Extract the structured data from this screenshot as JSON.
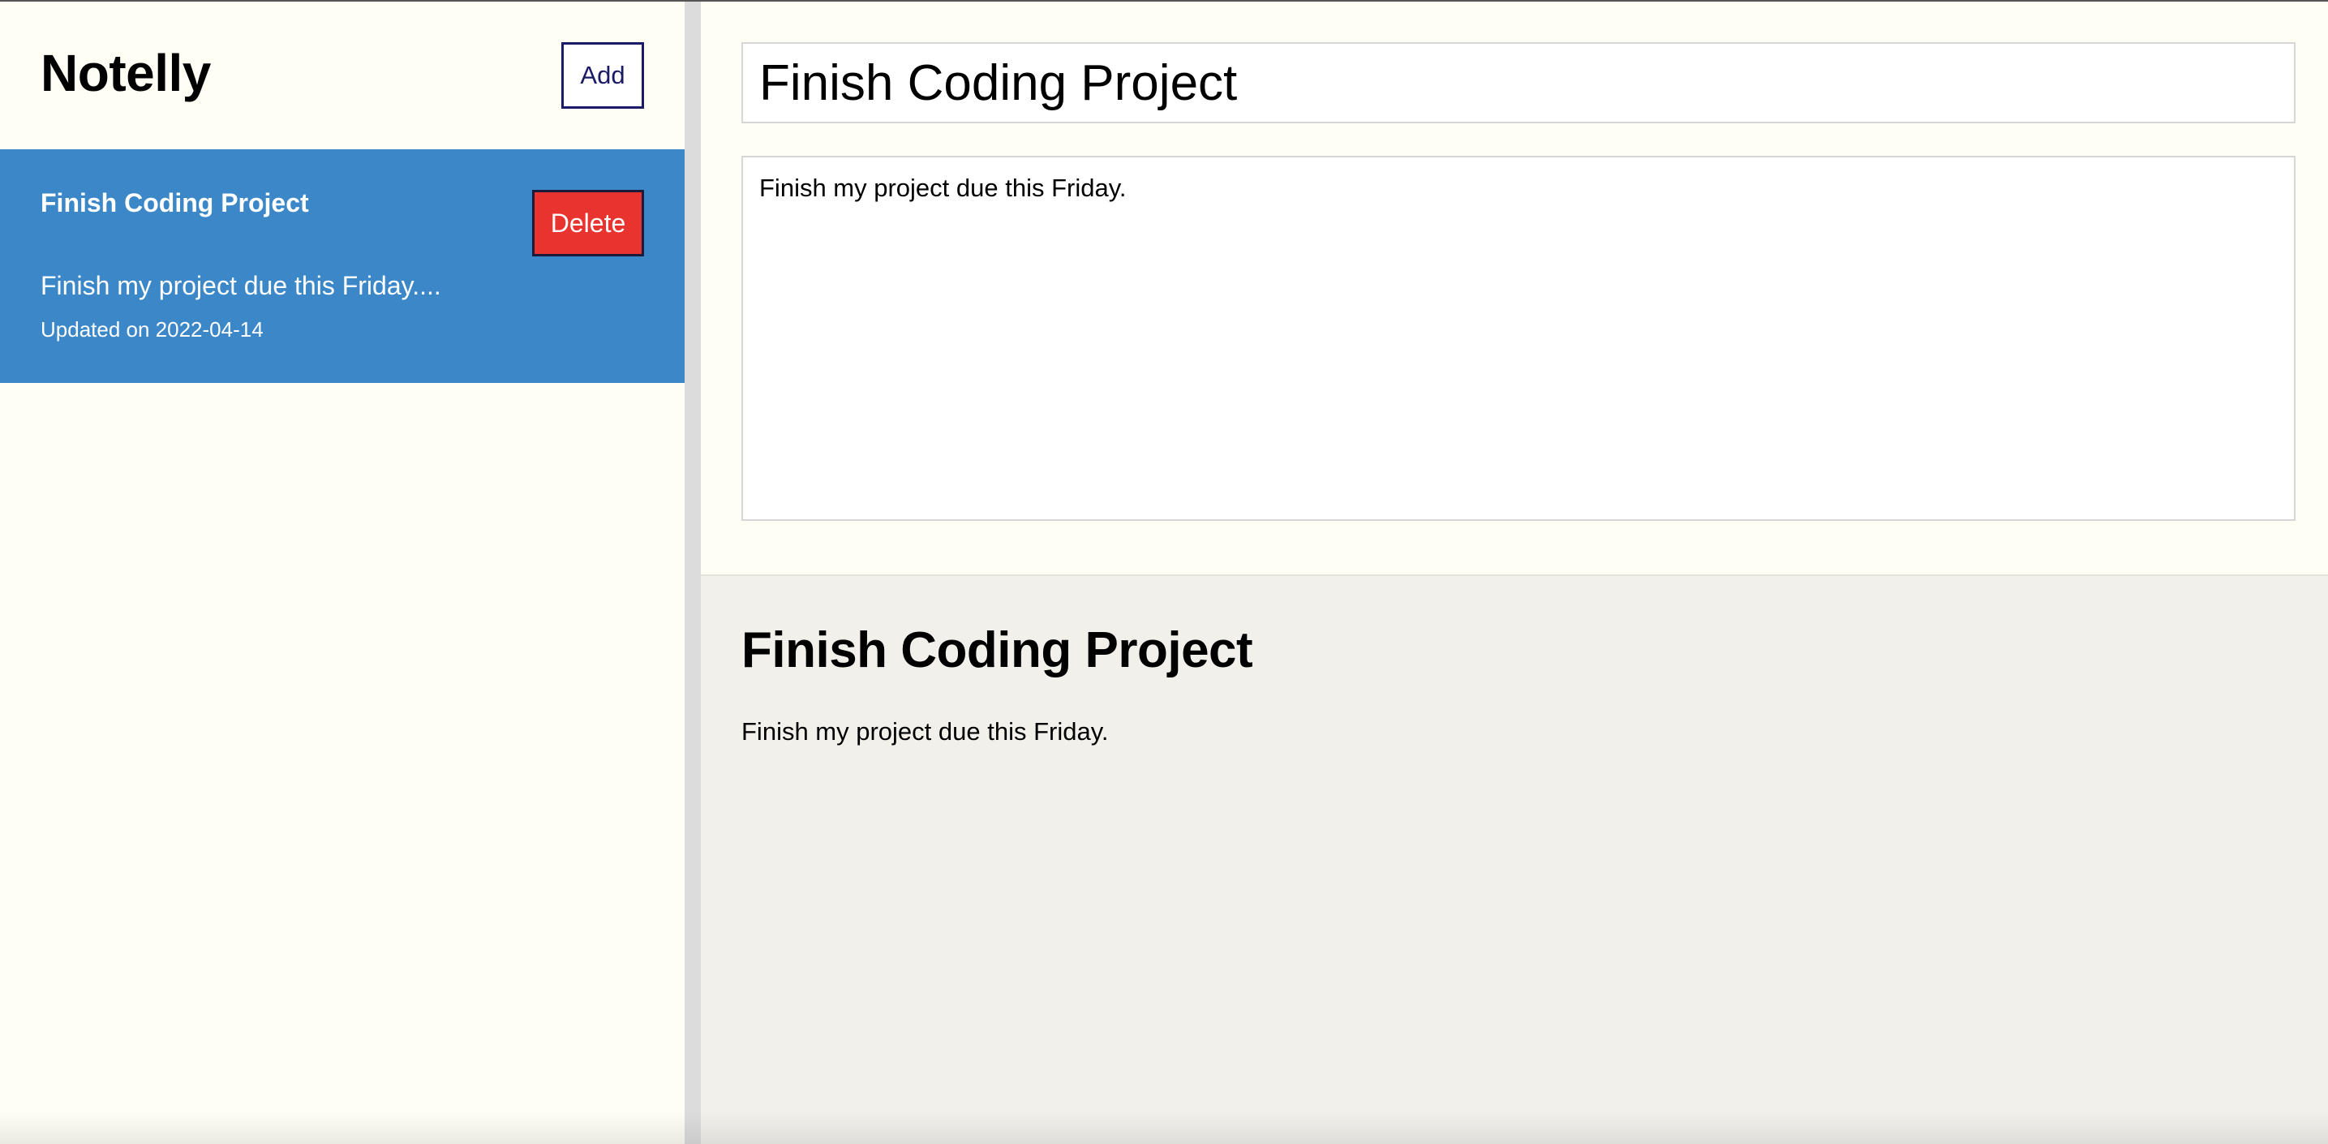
{
  "sidebar": {
    "app_title": "Notelly",
    "add_label": "Add",
    "notes": [
      {
        "title": "Finish Coding Project",
        "excerpt": "Finish my project due this Friday....",
        "updated": "Updated on 2022-04-14",
        "delete_label": "Delete",
        "selected": true
      }
    ]
  },
  "editor": {
    "title_value": "Finish Coding Project",
    "body_value": "Finish my project due this Friday."
  },
  "preview": {
    "title": "Finish Coding Project",
    "body": "Finish my project due this Friday."
  },
  "colors": {
    "background": "#fffef5",
    "selected_note": "#3b87c8",
    "delete_button": "#e8332e",
    "add_button_border": "#1a1a66",
    "preview_background": "#f1f0eb",
    "divider": "#dcdcdc"
  }
}
